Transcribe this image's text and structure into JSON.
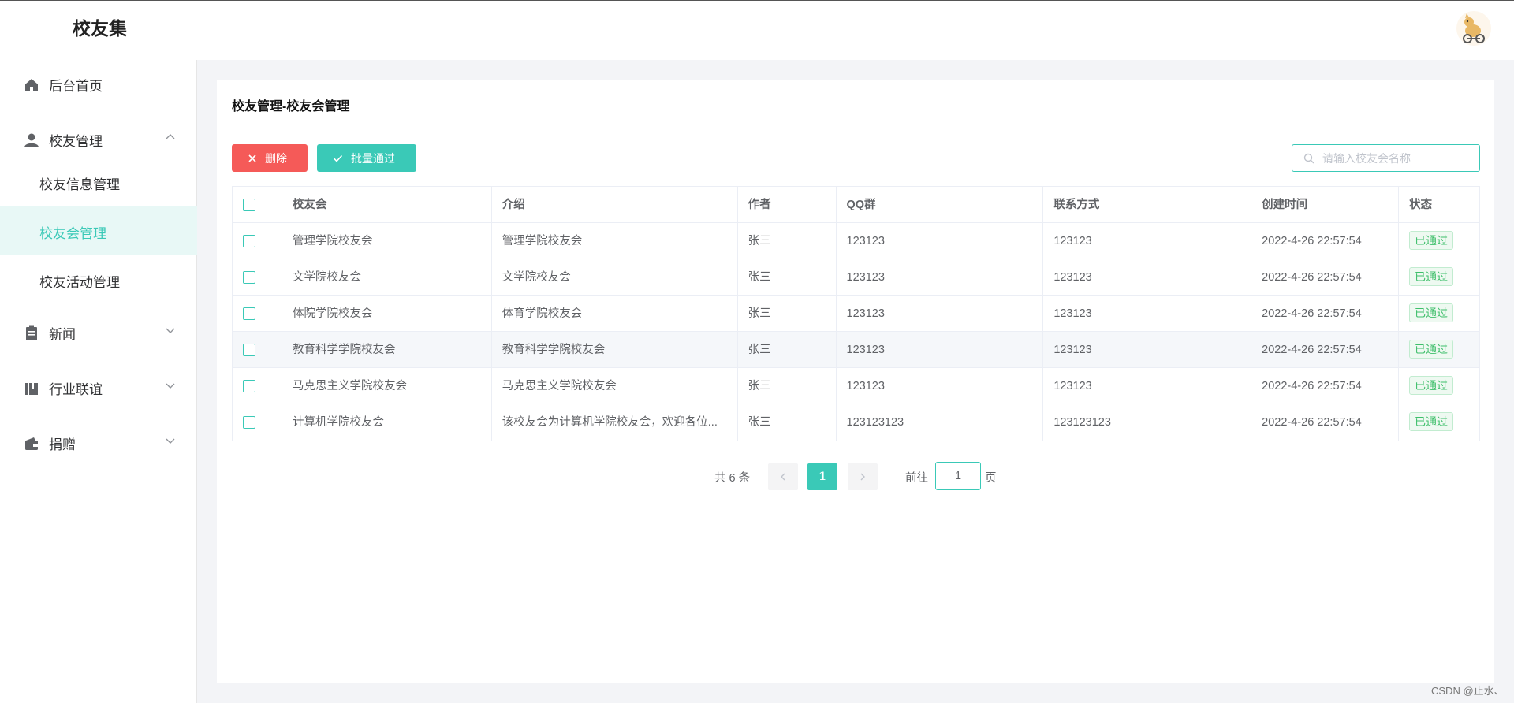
{
  "app": {
    "brand": "校友集",
    "watermark": "CSDN @止水、"
  },
  "sidebar": {
    "items": [
      {
        "label": "后台首页",
        "icon": "home-icon"
      },
      {
        "label": "校友管理",
        "icon": "user-icon",
        "expanded": true,
        "children": [
          {
            "label": "校友信息管理"
          },
          {
            "label": "校友会管理",
            "active": true
          },
          {
            "label": "校友活动管理"
          }
        ]
      },
      {
        "label": "新闻",
        "icon": "document-icon"
      },
      {
        "label": "行业联谊",
        "icon": "book-icon"
      },
      {
        "label": "捐赠",
        "icon": "wallet-icon"
      }
    ]
  },
  "panel": {
    "title": "校友管理-校友会管理",
    "delete_label": "删除",
    "batch_pass_label": "批量通过",
    "search_placeholder": "请输入校友会名称"
  },
  "table": {
    "headers": [
      "校友会",
      "介绍",
      "作者",
      "QQ群",
      "联系方式",
      "创建时间",
      "状态"
    ],
    "rows": [
      [
        "管理学院校友会",
        "管理学院校友会",
        "张三",
        "123123",
        "123123",
        "2022-4-26 22:57:54",
        "已通过"
      ],
      [
        "文学院校友会",
        "文学院校友会",
        "张三",
        "123123",
        "123123",
        "2022-4-26 22:57:54",
        "已通过"
      ],
      [
        "体院学院校友会",
        "体育学院校友会",
        "张三",
        "123123",
        "123123",
        "2022-4-26 22:57:54",
        "已通过"
      ],
      [
        "教育科学学院校友会",
        "教育科学学院校友会",
        "张三",
        "123123",
        "123123",
        "2022-4-26 22:57:54",
        "已通过"
      ],
      [
        "马克思主义学院校友会",
        "马克思主义学院校友会",
        "张三",
        "123123",
        "123123",
        "2022-4-26 22:57:54",
        "已通过"
      ],
      [
        "计算机学院校友会",
        "该校友会为计算机学院校友会，欢迎各位...",
        "张三",
        "123123123",
        "123123123",
        "2022-4-26 22:57:54",
        "已通过"
      ]
    ]
  },
  "pagination": {
    "total_text": "共 6 条",
    "current_page": "1",
    "goto_label": "前往",
    "goto_value": "1",
    "unit_label": "页"
  },
  "colors": {
    "accent": "#3ac9b7",
    "danger": "#f55a58",
    "success": "#3fbf6b"
  }
}
